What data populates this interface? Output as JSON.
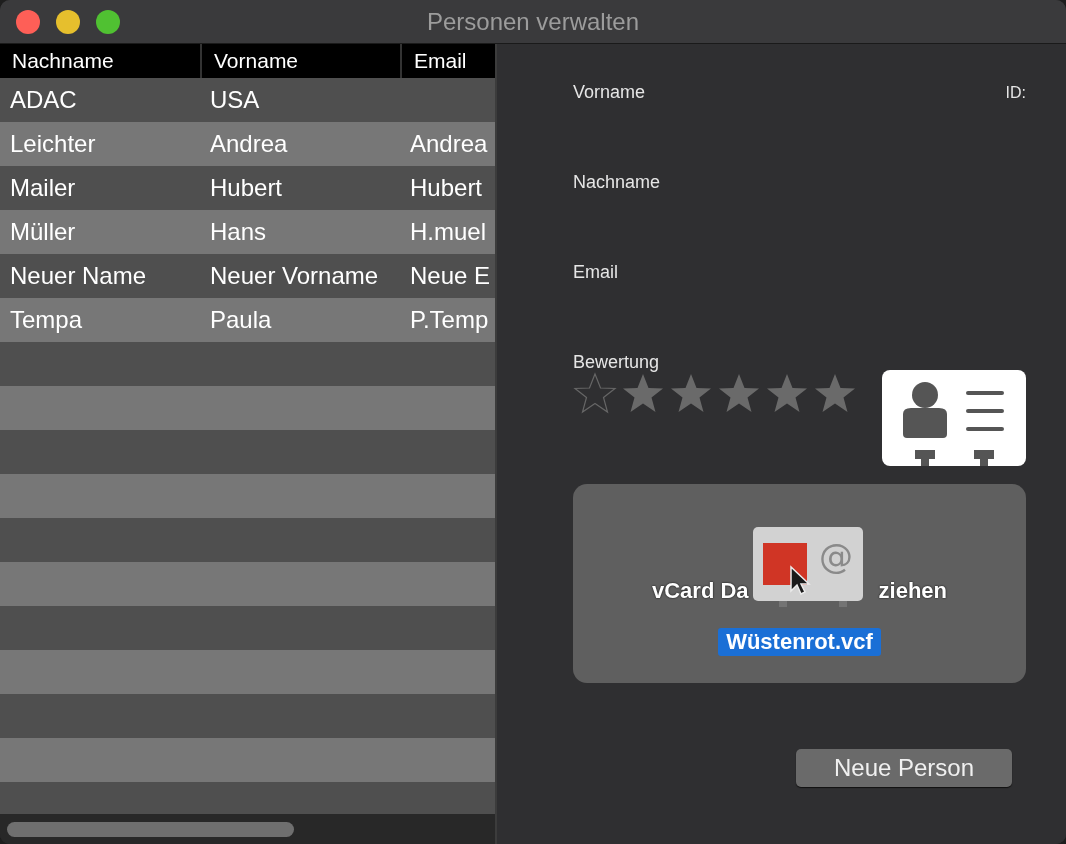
{
  "window": {
    "title": "Personen verwalten"
  },
  "table": {
    "columns": [
      "Nachname",
      "Vorname",
      "Email"
    ],
    "rows": [
      {
        "cells": [
          "ADAC",
          "USA",
          ""
        ]
      },
      {
        "cells": [
          "Leichter",
          "Andrea",
          "Andrea"
        ]
      },
      {
        "cells": [
          "Mailer",
          "Hubert",
          "Hubert"
        ]
      },
      {
        "cells": [
          "Müller",
          "Hans",
          "H.muel"
        ]
      },
      {
        "cells": [
          "Neuer Name",
          "Neuer Vorname",
          "Neue E"
        ]
      },
      {
        "cells": [
          "Tempa",
          "Paula",
          "P.Temp"
        ]
      }
    ]
  },
  "form": {
    "labels": [
      "Vorname",
      "Nachname",
      "Email",
      "Bewertung"
    ],
    "id_label": "ID:",
    "rating": {
      "stars": 5
    }
  },
  "drop_zone": {
    "hint_parts": [
      "vCard Da",
      "ziehen"
    ],
    "drag_symbol": "@",
    "file_name": "Wüstenrot.vcf"
  },
  "buttons": [
    "Neue Person"
  ]
}
